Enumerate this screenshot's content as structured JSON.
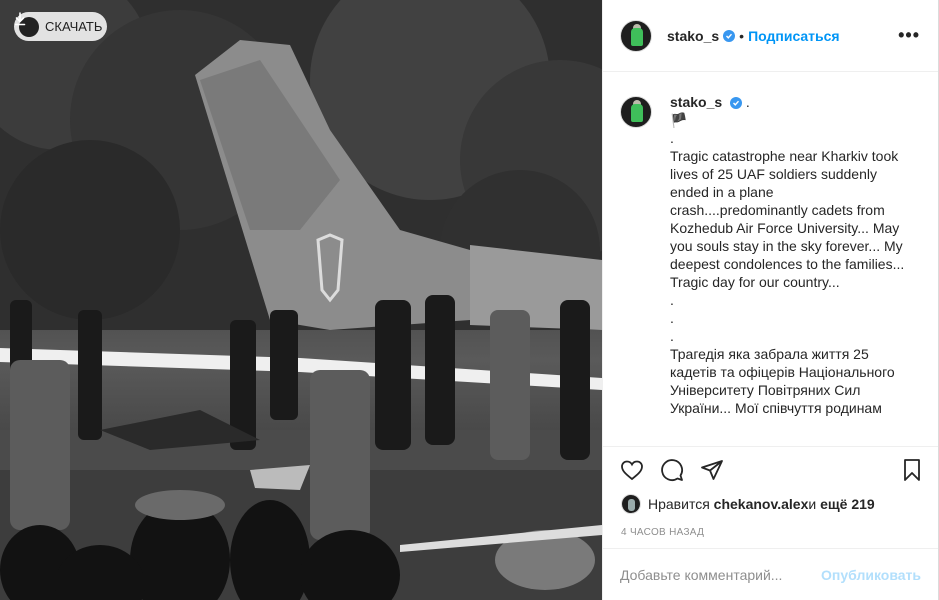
{
  "photo": {
    "download_label": "СКАЧАТЬ"
  },
  "header": {
    "username": "stako_s",
    "separator": "•",
    "follow_label": "Подписаться",
    "more_label": "•••"
  },
  "caption": {
    "username": "stako_s",
    "after_name": " .",
    "lines": [
      "🏴",
      ".",
      "Tragic catastrophe near Kharkiv took lives of 25 UAF soldiers suddenly ended in a plane crash....predominantly cadets from Kozhedub Air Force University... May you souls stay in the sky forever... My deepest condolences to the families...",
      "Tragic day for our country...",
      ".",
      ".",
      ".",
      "Трагедія яка забрала життя 25 кадетів та офіцерів Національного Університету Повітряних Сил України... Мої співчуття родинам"
    ]
  },
  "likes": {
    "prefix": "Нравится ",
    "user": "chekanov.alex",
    "middle": " и ",
    "count": "ещё 219"
  },
  "timestamp": "4 часов назад",
  "comment": {
    "placeholder": "Добавьте комментарий...",
    "publish_label": "Опубликовать"
  },
  "colors": {
    "link_blue": "#0095f6",
    "publish_disabled": "#b2dffc",
    "verified": "#3897f0"
  }
}
